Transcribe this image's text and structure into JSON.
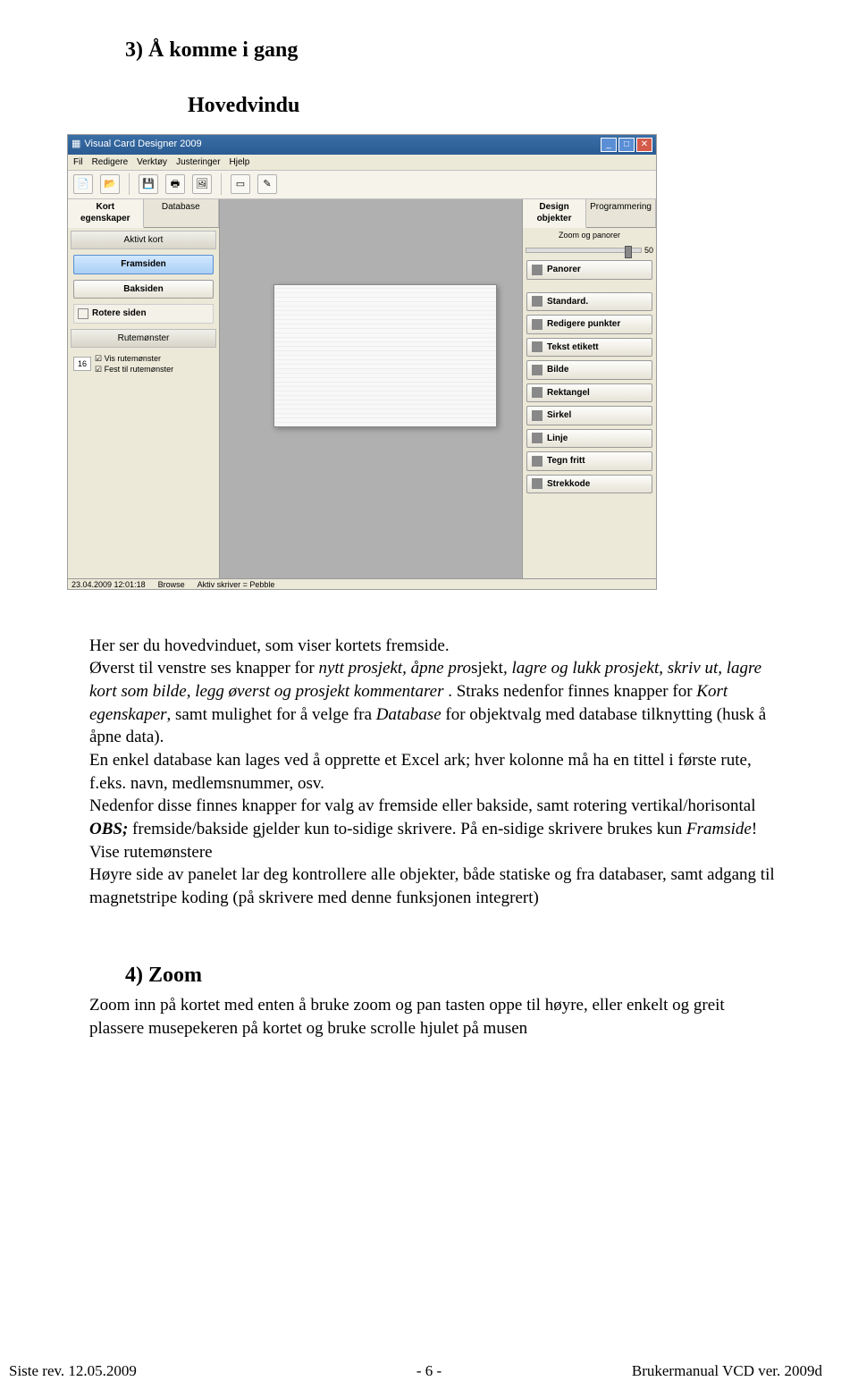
{
  "section3": {
    "heading": "3) Å komme i gang",
    "subheading": "Hovedvindu"
  },
  "app": {
    "title": "Visual Card Designer 2009",
    "menus": [
      "Fil",
      "Redigere",
      "Verktøy",
      "Justeringer",
      "Hjelp"
    ],
    "leftTabs": [
      "Kort egenskaper",
      "Database"
    ],
    "leftHeaders": {
      "aktivt": "Aktivt kort",
      "rute": "Rutemønster"
    },
    "leftButtons": {
      "fram": "Framsiden",
      "bak": "Baksiden",
      "rot": "Rotere siden"
    },
    "checks": {
      "vis": "Vis rutemønster",
      "fest": "Fest til rutemønster"
    },
    "gridnum": "16",
    "rightTabs": [
      "Design objekter",
      "Programmering"
    ],
    "rightHeader": "Zoom og panorer",
    "zoomVal": "50",
    "tools": [
      "Panorer",
      "Standard.",
      "Redigere punkter",
      "Tekst etikett",
      "Bilde",
      "Rektangel",
      "Sirkel",
      "Linje",
      "Tegn fritt",
      "Strekkode"
    ],
    "status": {
      "date": "23.04.2009 12:01:18",
      "browse": "Browse",
      "printer": "Aktiv skriver = Pebble"
    }
  },
  "body": {
    "p1a": "Her ser du hovedvinduet, som viser kortets fremside.",
    "p1b": "Øverst til venstre ses knapper for ",
    "p1b_i": "nytt prosjekt, åpne pro",
    "p1b_mid": "sjekt",
    "p1b_i2": ", lagre og lukk prosjekt, skriv ut,  lagre kort som bilde, legg øverst og prosjekt kommentarer ",
    "p1c": ". Straks nedenfor finnes knapper for ",
    "p1c_i": "Kort egenskaper",
    "p1d": ", samt mulighet for å velge fra ",
    "p1d_i": "Database",
    "p1e": " for objektvalg med database tilknytting (husk å åpne data).",
    "p2": "En enkel database kan lages ved å opprette et Excel ark; hver kolonne må ha en tittel i første rute, f.eks. navn, medlemsnummer, osv.",
    "p3a": "Nedenfor disse finnes knapper for valg av fremside eller bakside, samt rotering vertikal/horisontal ",
    "p3_obs": "OBS;",
    "p3b": " fremside/bakside gjelder kun to-sidige skrivere. På en-sidige skrivere brukes kun ",
    "p3_fram": "Framside",
    "p3c": "! Vise rutemønstere",
    "p4": "Høyre side av panelet lar deg kontrollere alle objekter, både statiske og fra databaser, samt adgang til magnetstripe koding (på skrivere med denne funksjonen integrert)"
  },
  "section4": {
    "heading": "4)      Zoom",
    "text": "Zoom inn på kortet med enten å bruke zoom og pan tasten oppe til høyre, eller enkelt og greit plassere musepekeren på kortet og bruke scrolle hjulet på musen"
  },
  "footer": {
    "left": "Siste rev. 12.05.2009",
    "center": "- 6 -",
    "right": "Brukermanual VCD ver. 2009d"
  }
}
